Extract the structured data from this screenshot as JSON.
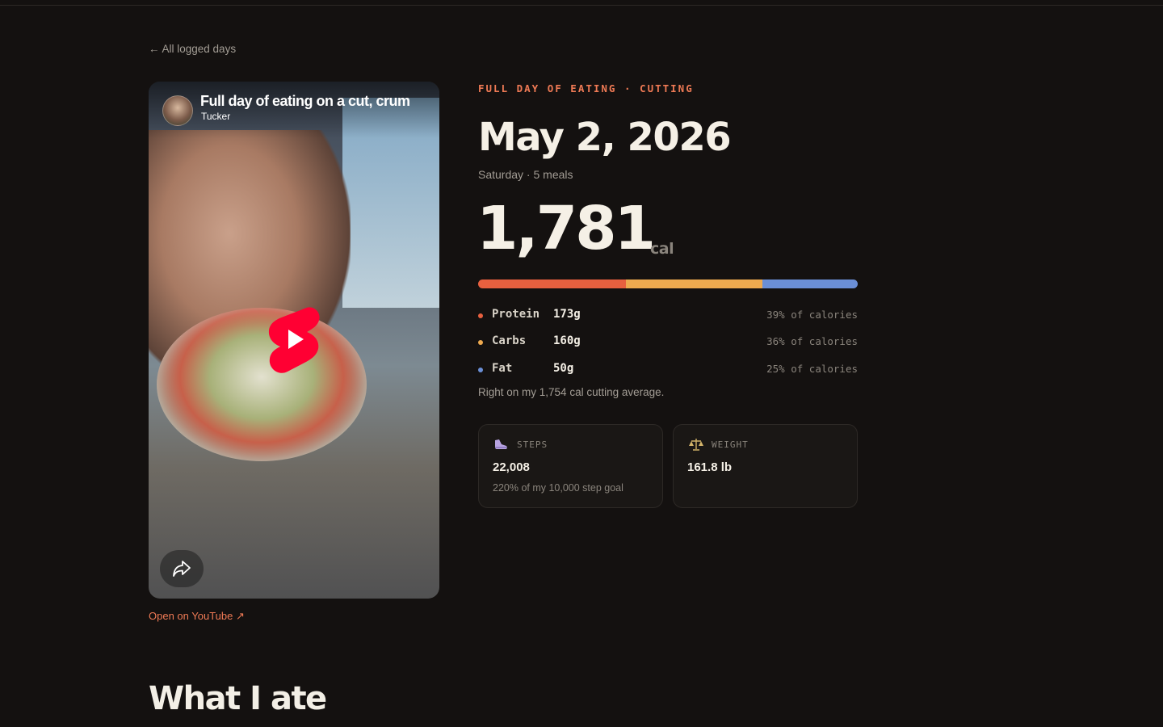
{
  "nav": {
    "back_label": "← All logged days"
  },
  "video": {
    "title": "Full day of eating on a cut, crum",
    "channel": "Tucker",
    "external_link": "Open on YouTube ↗"
  },
  "day": {
    "eyebrow": "FULL DAY OF EATING · CUTTING",
    "date": "May 2, 2026",
    "subline": "Saturday · 5 meals",
    "calories": "1,781",
    "calories_unit": "cal",
    "average_note": "Right on my 1,754 cal cutting average."
  },
  "macros": [
    {
      "name": "Protein",
      "grams": "173g",
      "pct_label": "39% of calories",
      "share": 0.39,
      "color": "#e8603f"
    },
    {
      "name": "Carbs",
      "grams": "160g",
      "pct_label": "36% of calories",
      "share": 0.36,
      "color": "#eeaa4f"
    },
    {
      "name": "Fat",
      "grams": "50g",
      "pct_label": "25% of calories",
      "share": 0.25,
      "color": "#6b8fd6"
    }
  ],
  "stats": {
    "steps": {
      "icon": "sneaker-icon",
      "label": "STEPS",
      "value": "22,008",
      "note": "220% of my 10,000 step goal"
    },
    "weight": {
      "icon": "scale-icon",
      "label": "WEIGHT",
      "value": "161.8 lb"
    }
  },
  "sections": {
    "meals_heading": "What I ate"
  },
  "colors": {
    "accent": "#ef7a55",
    "background": "#141110",
    "text": "#f5f0e6"
  }
}
